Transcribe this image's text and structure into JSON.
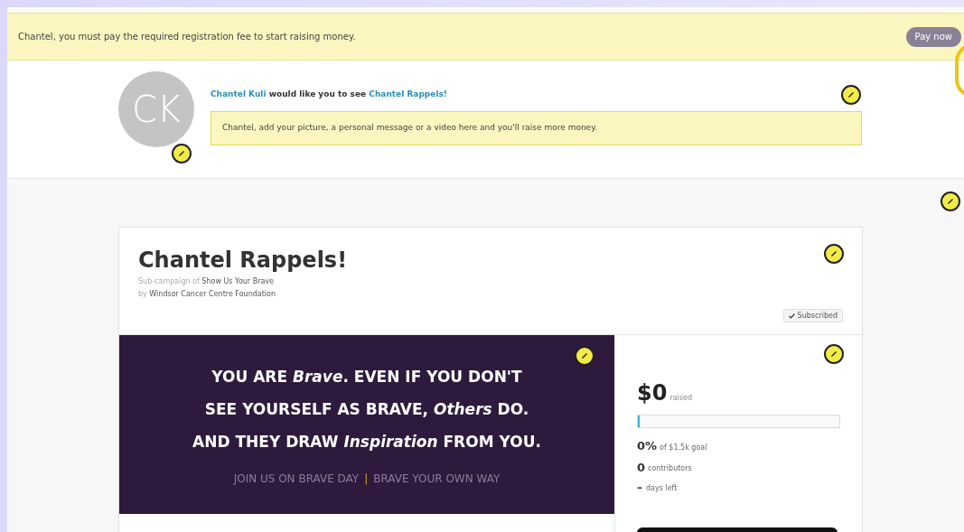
{
  "notice": {
    "message": "Chantel, you must pay the required registration fee to start raising money.",
    "button": "Pay now"
  },
  "invite": {
    "avatar_initials": "CK",
    "inviter": "Chantel Kuli",
    "middle": "would like you to see",
    "campaign": "Chantel Rappels!",
    "hint": "Chantel, add your picture, a personal message or a video here and you'll raise more money."
  },
  "campaign": {
    "title": "Chantel Rappels!",
    "sub_prefix": "Sub-campaign of",
    "parent": "Show Us Your Brave",
    "by_prefix": "by",
    "organization": "Windsor Cancer Centre Foundation",
    "subscribed": {
      "label": "Subscribed",
      "checked": true
    }
  },
  "banner": {
    "lines": [
      "YOU ARE *Brave*. EVEN IF YOU DON'T",
      "SEE YOURSELF AS BRAVE, *Others* DO.",
      "AND THEY DRAW *Inspiration* FROM YOU."
    ],
    "tagline_left": "JOIN US ON BRAVE DAY",
    "separator": "|",
    "tagline_right": "BRAVE YOUR OWN WAY"
  },
  "stats": {
    "amount": "$0",
    "amount_label": "raised",
    "level": 0,
    "percent": "0%",
    "goal": "of $1.5k goal",
    "contributors": "0",
    "contributors_label": "contributors",
    "days": "–",
    "days_label": "days left"
  }
}
